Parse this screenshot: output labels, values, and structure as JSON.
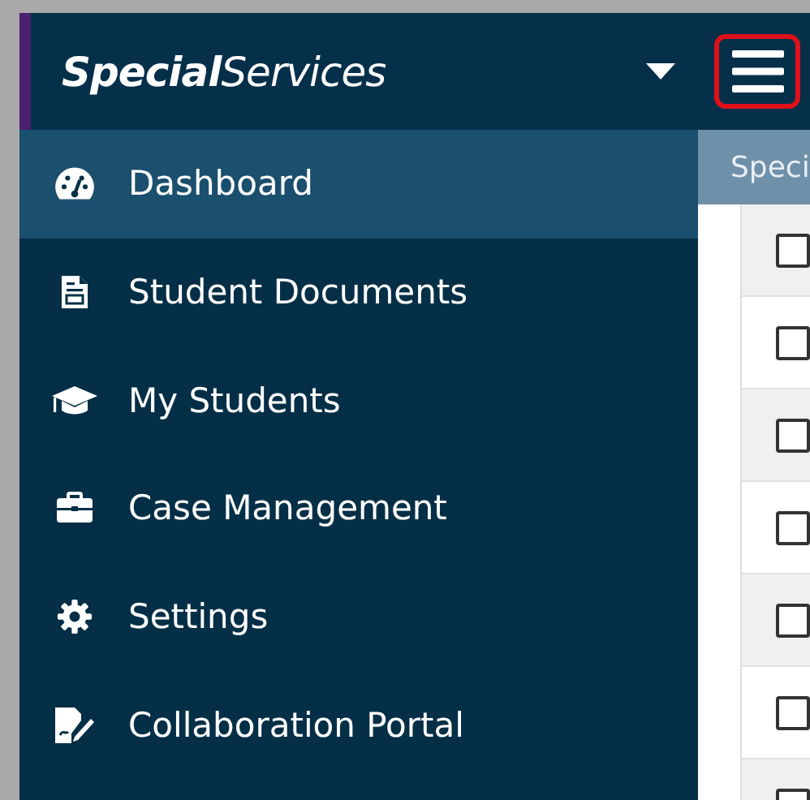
{
  "header": {
    "brand": "**Special**Services"
  },
  "sidebar": {
    "items": [
      {
        "label": "Dashboard",
        "selected": true
      },
      {
        "label": "Student Documents",
        "selected": false
      },
      {
        "label": "My Students",
        "selected": false
      },
      {
        "label": "Case Management",
        "selected": false
      },
      {
        "label": "Settings",
        "selected": false
      },
      {
        "label": "Collaboration Portal",
        "selected": false
      }
    ]
  },
  "table": {
    "heading": "Speci",
    "rows": [
      {
        "checked": false
      },
      {
        "checked": false
      },
      {
        "checked": false
      },
      {
        "checked": false
      },
      {
        "checked": false
      },
      {
        "checked": false
      },
      {
        "checked": false
      }
    ]
  }
}
